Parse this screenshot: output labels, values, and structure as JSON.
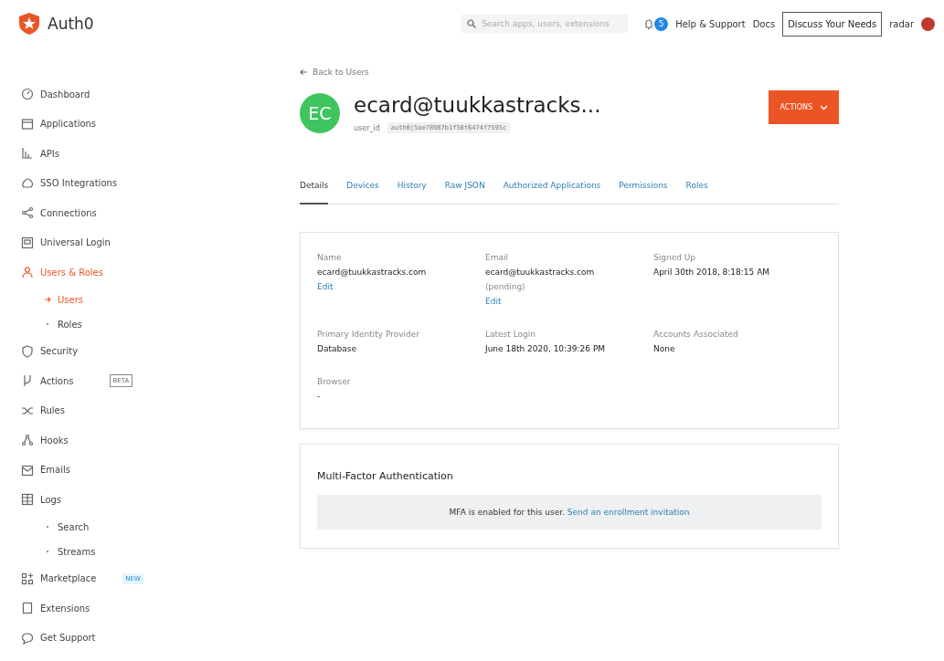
{
  "brand": {
    "name": "Auth0"
  },
  "topbar": {
    "search": {
      "placeholder": "Search apps, users, extensions"
    },
    "notification_count": "5",
    "links": [
      "Help & Support",
      "Docs"
    ],
    "cta": "Discuss Your Needs",
    "tenant": "radar"
  },
  "sidebar": {
    "items": [
      {
        "kind": "item",
        "label": "Dashboard",
        "selected": false
      },
      {
        "kind": "item",
        "label": "Applications",
        "selected": false
      },
      {
        "kind": "item",
        "label": "APIs",
        "selected": false
      },
      {
        "kind": "item",
        "label": "SSO Integrations",
        "selected": false
      },
      {
        "kind": "item",
        "label": "Connections",
        "selected": false
      },
      {
        "kind": "item",
        "label": "Universal Login",
        "selected": false
      },
      {
        "kind": "item",
        "label": "Users & Roles",
        "selected": true
      },
      {
        "kind": "subitem",
        "label": "Users",
        "selected": true
      },
      {
        "kind": "subitem",
        "label": "Roles",
        "selected": false
      },
      {
        "kind": "item",
        "label": "Security",
        "selected": false
      },
      {
        "kind": "item",
        "label": "Actions",
        "selected": false,
        "badge": {
          "kind": "outline",
          "text": "BETA"
        }
      },
      {
        "kind": "item",
        "label": "Rules",
        "selected": false
      },
      {
        "kind": "item",
        "label": "Hooks",
        "selected": false
      },
      {
        "kind": "item",
        "label": "Emails",
        "selected": false
      },
      {
        "kind": "item",
        "label": "Logs",
        "selected": false
      },
      {
        "kind": "subitem",
        "label": "Search",
        "selected": false
      },
      {
        "kind": "subitem",
        "label": "Streams",
        "selected": false
      },
      {
        "kind": "item",
        "label": "Marketplace",
        "selected": false,
        "badge": {
          "kind": "filled",
          "text": "NEW"
        }
      },
      {
        "kind": "item",
        "label": "Extensions",
        "selected": false
      },
      {
        "kind": "item",
        "label": "Get Support",
        "selected": false
      }
    ]
  },
  "page": {
    "back_link": "Back to Users",
    "avatar_initials": "EC",
    "title": "ecard@tuukkastracks...",
    "user_id_label": "user_id",
    "user_id": "auth0|5ae78987b1f58f6474f7595c",
    "actions_button": "ACTIONS",
    "tabs": [
      {
        "label": "Details",
        "selected": true
      },
      {
        "label": "Devices",
        "selected": false
      },
      {
        "label": "History",
        "selected": false
      },
      {
        "label": "Raw JSON",
        "selected": false
      },
      {
        "label": "Authorized Applications",
        "selected": false
      },
      {
        "label": "Permissions",
        "selected": false
      },
      {
        "label": "Roles",
        "selected": false
      }
    ],
    "fields": [
      {
        "label": "Name",
        "value": "ecard@tuukkastracks.com",
        "edit": "Edit"
      },
      {
        "label": "Email",
        "value": "ecard@tuukkastracks.com",
        "note": "(pending)",
        "edit": "Edit"
      },
      {
        "label": "Signed Up",
        "value": "April 30th 2018, 8:18:15 AM"
      },
      {
        "label": "Primary Identity Provider",
        "value": "Database"
      },
      {
        "label": "Latest Login",
        "value": "June 18th 2020, 10:39:26 PM"
      },
      {
        "label": "Accounts Associated",
        "value": "None"
      },
      {
        "label": "Browser",
        "value": "-"
      }
    ],
    "mfa": {
      "title": "Multi-Factor Authentication",
      "message": "MFA is enabled for this user.",
      "link": "Send an enrollment invitation"
    }
  }
}
